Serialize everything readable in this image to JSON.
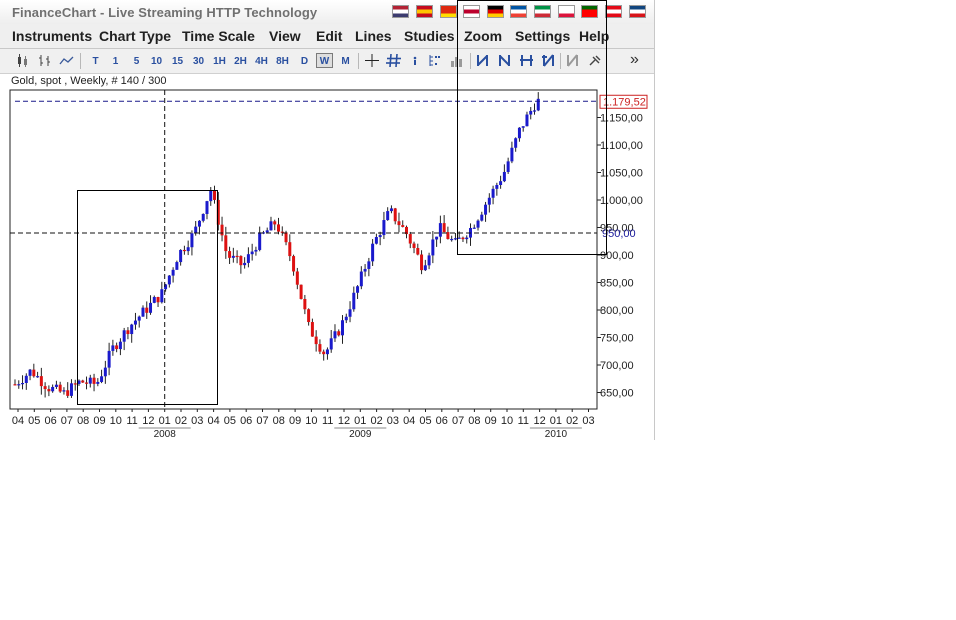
{
  "window": {
    "title": "FinanceChart - Live Streaming HTTP Technology"
  },
  "flags": [
    {
      "name": "us-flag-icon",
      "colors": [
        "#b22234",
        "#ffffff",
        "#3c3b6e"
      ]
    },
    {
      "name": "es-flag-icon",
      "colors": [
        "#c60b1e",
        "#ffc400",
        "#c60b1e"
      ]
    },
    {
      "name": "cn-flag-icon",
      "colors": [
        "#de2910",
        "#de2910",
        "#ffde00"
      ]
    },
    {
      "name": "jp-flag-icon",
      "colors": [
        "#ffffff",
        "#bc002d",
        "#ffffff"
      ]
    },
    {
      "name": "de-flag-icon",
      "colors": [
        "#000000",
        "#dd0000",
        "#ffce00"
      ]
    },
    {
      "name": "fr-flag-icon",
      "colors": [
        "#0055a4",
        "#ffffff",
        "#ef4135"
      ]
    },
    {
      "name": "it-flag-icon",
      "colors": [
        "#009246",
        "#ffffff",
        "#ce2b37"
      ]
    },
    {
      "name": "pl-flag-icon",
      "colors": [
        "#ffffff",
        "#ffffff",
        "#dc143c"
      ]
    },
    {
      "name": "pt-flag-icon",
      "colors": [
        "#006600",
        "#ff0000",
        "#ff0000"
      ]
    },
    {
      "name": "tr-flag-icon",
      "colors": [
        "#e30a17",
        "#ffffff",
        "#e30a17"
      ]
    },
    {
      "name": "cz-flag-icon",
      "colors": [
        "#11457e",
        "#ffffff",
        "#d7141a"
      ]
    }
  ],
  "menu": [
    "Instruments",
    "Chart Type",
    "Time Scale",
    "View",
    "Edit",
    "Lines",
    "Studies",
    "Zoom",
    "Settings",
    "Help"
  ],
  "toolbar": {
    "timeframes": [
      "T",
      "1",
      "5",
      "10",
      "15",
      "30",
      "1H",
      "2H",
      "4H",
      "8H",
      "D",
      "W",
      "M"
    ],
    "selected": "W",
    "more": "»"
  },
  "chart_caption": "Gold, spot , Weekly, # 140 / 300",
  "chart_data": {
    "type": "candlestick",
    "title": "Gold, spot , Weekly, # 140 / 300",
    "ylim": [
      620,
      1200
    ],
    "y_ticks": [
      "650,00",
      "700,00",
      "750,00",
      "800,00",
      "850,00",
      "900,00",
      "950,00",
      "1.000,00",
      "1.050,00",
      "1.100,00",
      "1.150,00"
    ],
    "x_ticks": [
      "04",
      "05",
      "06",
      "07",
      "08",
      "09",
      "10",
      "11",
      "12",
      "01",
      "02",
      "03",
      "04",
      "05",
      "06",
      "07",
      "08",
      "09",
      "10",
      "11",
      "12",
      "01",
      "02",
      "03",
      "04",
      "05",
      "06",
      "07",
      "08",
      "09",
      "10",
      "11",
      "12",
      "01",
      "02",
      "03"
    ],
    "year_labels": [
      {
        "label": "2008",
        "month_index": 9
      },
      {
        "label": "2009",
        "month_index": 21
      },
      {
        "label": "2010",
        "month_index": 33
      }
    ],
    "last_price_label": "1.179,52",
    "last_price": 1179.52,
    "crosshair_label": "950,00",
    "crosshair_price": 940,
    "grid": false,
    "monthly_path": [
      665,
      690,
      660,
      648,
      670,
      665,
      730,
      770,
      800,
      830,
      900,
      940,
      1020,
      900,
      880,
      930,
      960,
      890,
      770,
      720,
      770,
      840,
      920,
      980,
      940,
      880,
      950,
      920,
      950,
      1000,
      1050,
      1130,
      1180
    ],
    "volatility_seed": 7,
    "bull_color": "#1a1acc",
    "bear_color": "#dd1111"
  }
}
